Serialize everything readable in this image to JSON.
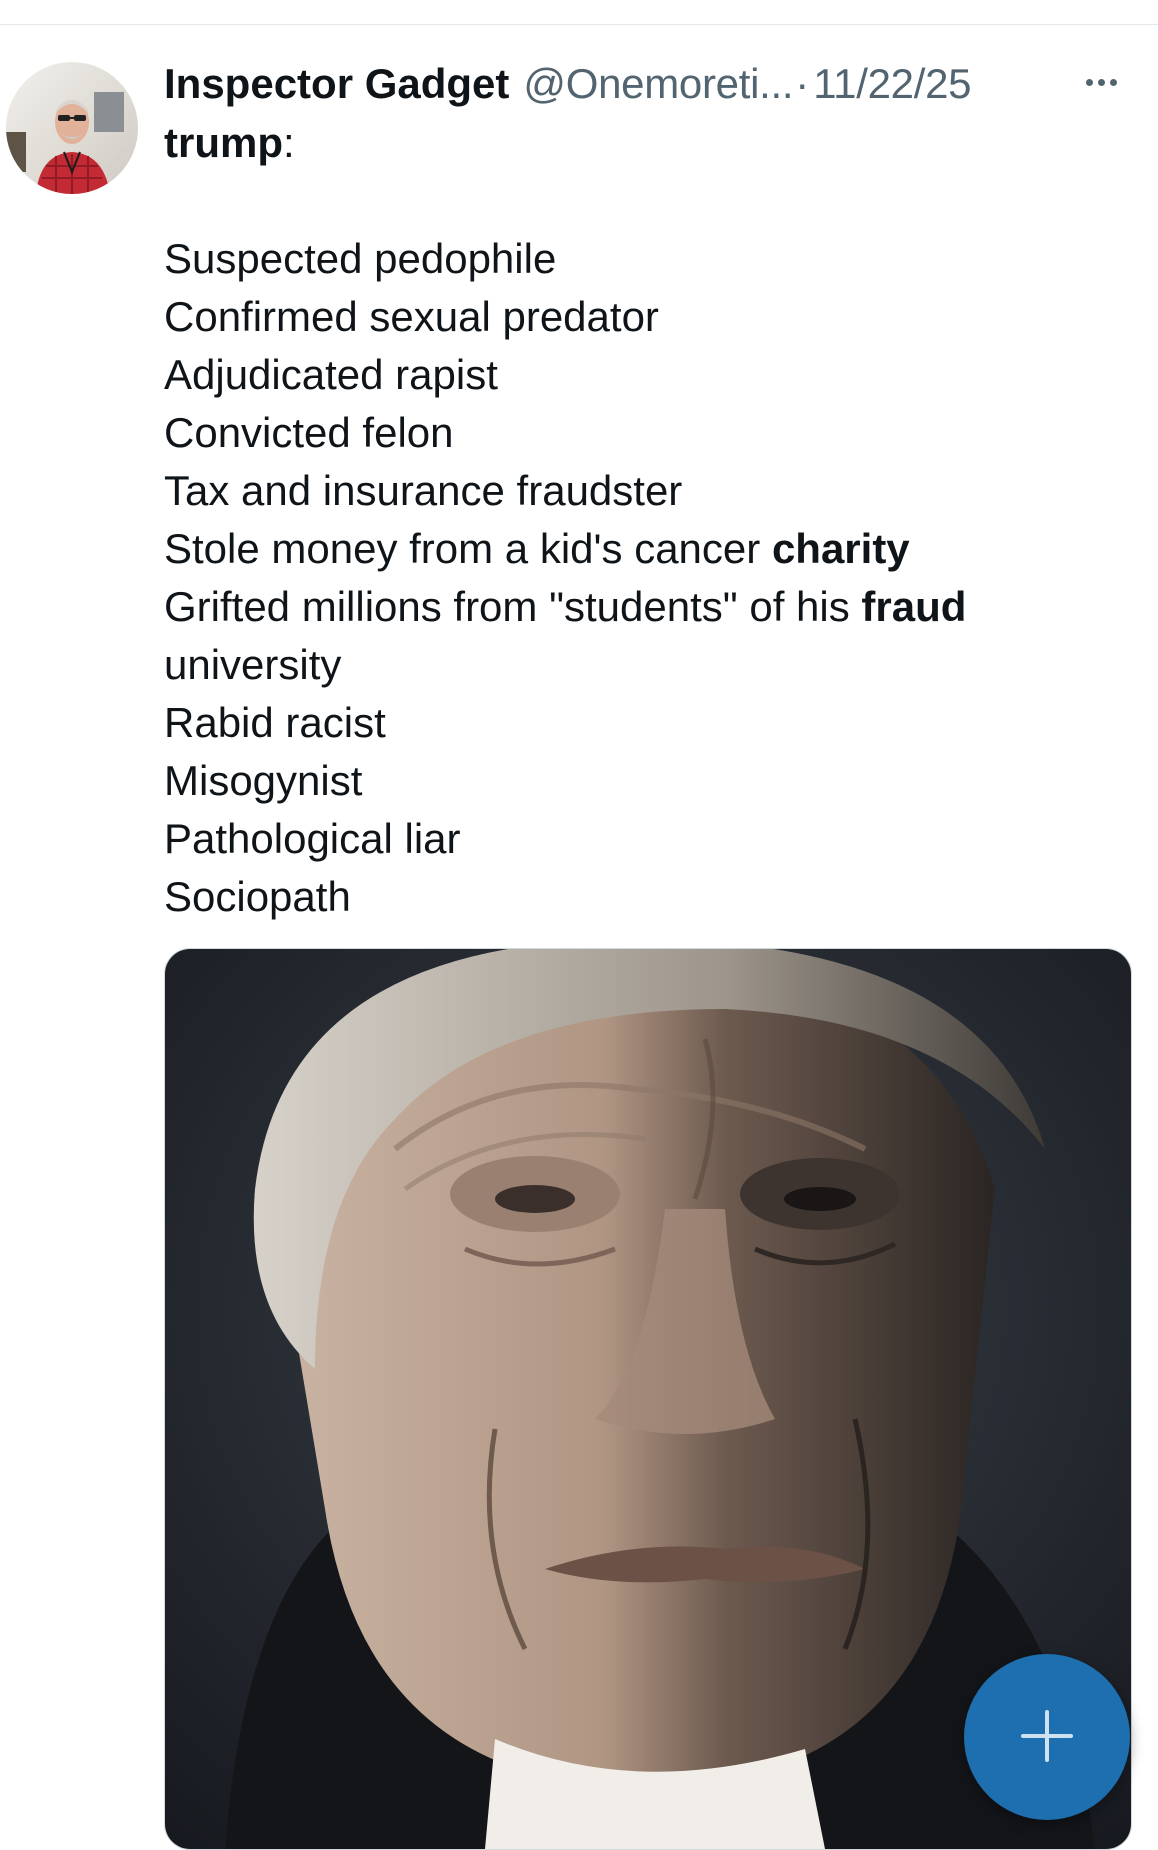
{
  "tweet": {
    "author": {
      "display_name": "Inspector Gadget",
      "handle": "@Onemoreti...",
      "avatar_icon": "profile-photo"
    },
    "separator": "·",
    "date": "11/22/25",
    "more_icon": "more-options-icon",
    "text": {
      "subject": "trump",
      "subject_colon": ":",
      "items": [
        "Suspected pedophile",
        "Confirmed sexual predator",
        "Adjudicated rapist",
        "Convicted felon",
        "Tax and insurance fraudster"
      ],
      "item_charity_prefix": "Stole money from a kid's cancer ",
      "item_charity_bold": "charity",
      "item_university_prefix": "Grifted millions from \"students\" of his ",
      "item_university_bold": "fraud",
      "item_university_rest": "university",
      "items_after": [
        "Rabid racist",
        "Misogynist",
        "Pathological liar",
        "Sociopath"
      ]
    },
    "media": {
      "type": "photo"
    }
  },
  "compose_button": {
    "icon": "plus-icon"
  },
  "colors": {
    "text_primary": "#0f1419",
    "text_secondary": "#536471",
    "fab": "#1d6fb0"
  }
}
